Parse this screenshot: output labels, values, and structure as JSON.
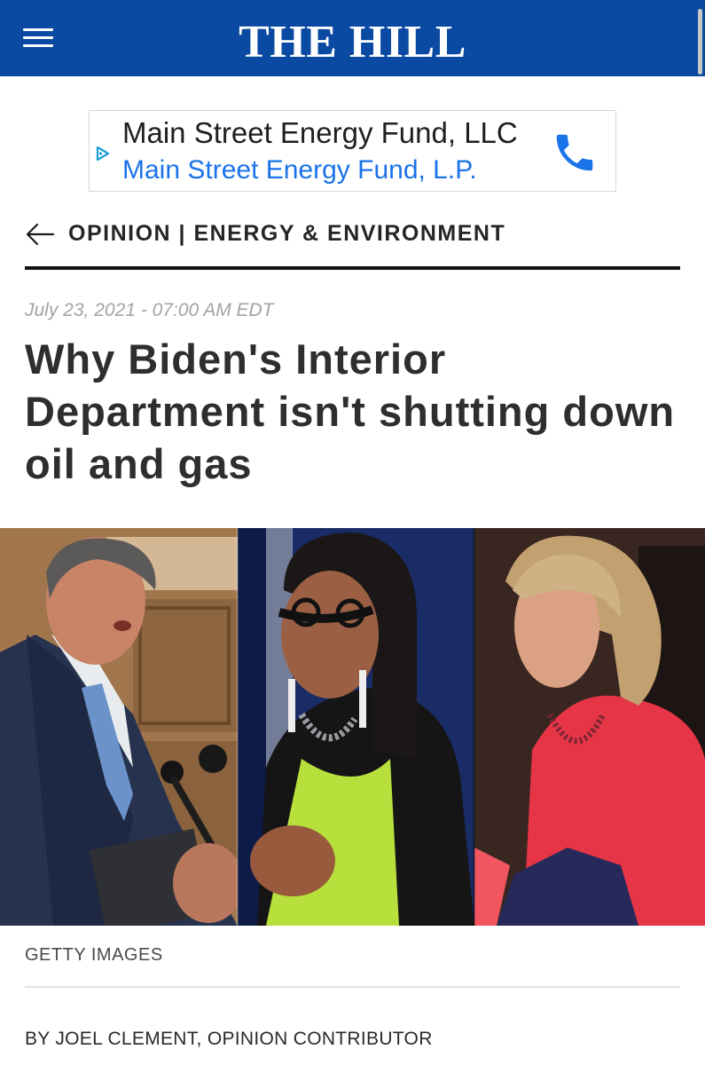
{
  "header": {
    "logo": "THE HILL",
    "menu_icon": "hamburger-menu-icon",
    "background_color": "#0b4aa2"
  },
  "ad": {
    "title": "Main Street Energy Fund, LLC",
    "subtitle": "Main Street Energy Fund, L.P.",
    "choice_icon": "ad-choices-icon",
    "call_icon": "phone-icon",
    "link_color": "#1a73e8",
    "icon_color": "#1a73e8"
  },
  "section": {
    "back_icon": "back-arrow-icon",
    "label": "OPINION | ENERGY & ENVIRONMENT"
  },
  "article": {
    "date": "July 23, 2021 - 07:00 AM EDT",
    "headline": "Why Biden's Interior Department isn't shutting down oil and gas",
    "photo_credit": "GETTY IMAGES",
    "byline": "BY JOEL CLEMENT, OPINION CONTRIBUTOR"
  }
}
